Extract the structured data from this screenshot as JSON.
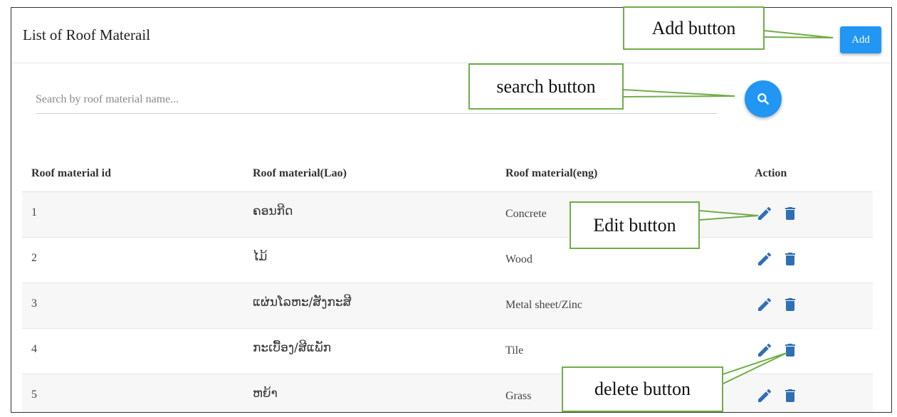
{
  "header": {
    "title": "List of Roof Materail",
    "add_label": "Add"
  },
  "search": {
    "placeholder": "Search by roof material name...",
    "value": "",
    "button_icon": "search-icon"
  },
  "table": {
    "headers": [
      "Roof material id",
      "Roof material(Lao)",
      "Roof material(eng)",
      "Action"
    ],
    "rows": [
      {
        "id": "1",
        "lao": "ຄອນກີດ",
        "eng": "Concrete"
      },
      {
        "id": "2",
        "lao": "ໄມ້",
        "eng": "Wood"
      },
      {
        "id": "3",
        "lao": "ແຜ່ນໂລຫະ/ສັງກະສີ",
        "eng": "Metal sheet/Zinc"
      },
      {
        "id": "4",
        "lao": "ກະເບື້ອງ/ສີແພັກ",
        "eng": "Tile"
      },
      {
        "id": "5",
        "lao": "ຫຍ້າ",
        "eng": "Grass"
      }
    ],
    "action_icons": [
      "edit-icon",
      "delete-icon"
    ]
  },
  "annotations": {
    "add": "Add button",
    "search": "search button",
    "edit": "Edit button",
    "delete": "delete button"
  },
  "colors": {
    "primary": "#2196f3",
    "icon": "#2f6fb3",
    "annotation_border": "#70ad47"
  }
}
